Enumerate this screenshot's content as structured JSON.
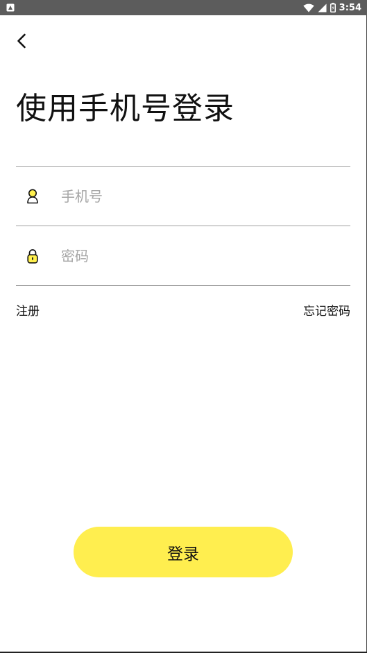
{
  "status_bar": {
    "time": "3:54"
  },
  "header": {
    "title": "使用手机号登录"
  },
  "form": {
    "phone_placeholder": "手机号",
    "phone_value": "",
    "password_placeholder": "密码",
    "password_value": ""
  },
  "links": {
    "register": "注册",
    "forgot_password": "忘记密码"
  },
  "actions": {
    "login_label": "登录"
  },
  "colors": {
    "accent": "#ffee4f",
    "status_bar": "#5c5c5c",
    "divider": "#9e9e9e",
    "placeholder": "#a6a6a6"
  },
  "icons": {
    "back": "chevron-left-icon",
    "phone_field": "user-icon",
    "password_field": "lock-icon"
  }
}
